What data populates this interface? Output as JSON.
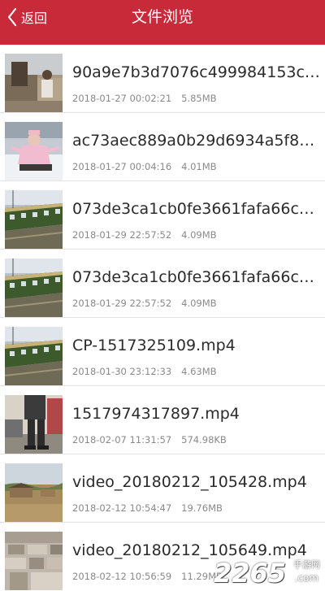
{
  "header": {
    "back_label": "返回",
    "title": "文件浏览",
    "background": "#c92a3a"
  },
  "files": [
    {
      "name": "90a9e7b3d7076c499984153c…",
      "date": "2018-01-27 00:02:21",
      "size": "5.85MB",
      "thumb": "outdoor-people"
    },
    {
      "name": "ac73aec889a0b29d6934a5f84…",
      "date": "2018-01-27 00:04:16",
      "size": "4.01MB",
      "thumb": "snow-person"
    },
    {
      "name": "073de3ca1cb0fe3661fafa66c2…",
      "date": "2018-01-29 22:57:52",
      "size": "4.09MB",
      "thumb": "train"
    },
    {
      "name": "073de3ca1cb0fe3661fafa66c2…",
      "date": "2018-01-29 22:57:52",
      "size": "4.09MB",
      "thumb": "train"
    },
    {
      "name": "CP-1517325109.mp4",
      "date": "2018-01-30 23:12:33",
      "size": "4.63MB",
      "thumb": "train"
    },
    {
      "name": "1517974317897.mp4",
      "date": "2018-02-07 11:31:57",
      "size": "574.98KB",
      "thumb": "person-car"
    },
    {
      "name": "video_20180212_105428.mp4",
      "date": "2018-02-12 10:54:47",
      "size": "19.76MB",
      "thumb": "village"
    },
    {
      "name": "video_20180212_105649.mp4",
      "date": "2018-02-12 10:56:59",
      "size": "11.29MB",
      "thumb": "stone-wall"
    }
  ],
  "watermark": {
    "number": "2265",
    "sub": "手游网",
    "dot": ".com"
  }
}
